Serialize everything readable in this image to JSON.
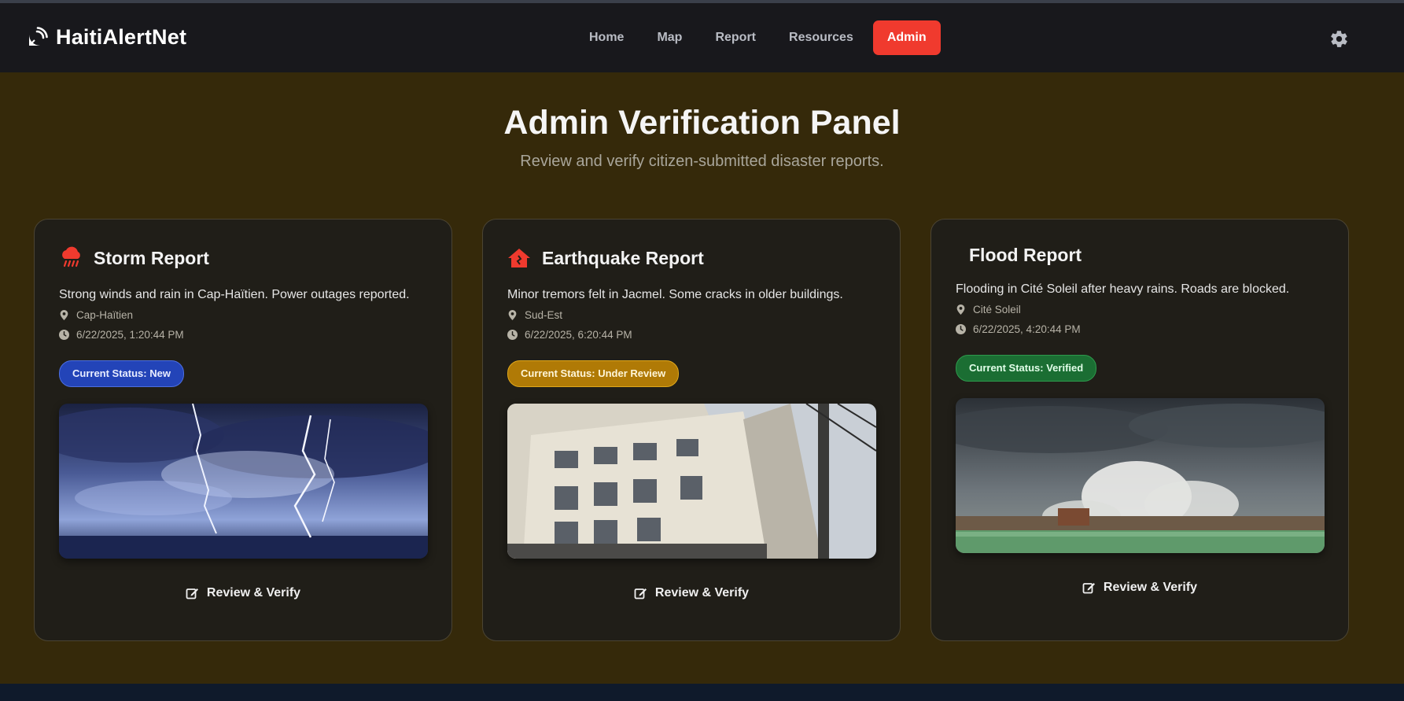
{
  "brand": {
    "name": "HaitiAlertNet",
    "icon": "satellite-dish-icon"
  },
  "nav": {
    "links": [
      "Home",
      "Map",
      "Report",
      "Resources",
      "Admin"
    ],
    "active": "Admin",
    "settings_icon": "gear-icon"
  },
  "page": {
    "title": "Admin Verification Panel",
    "subtitle": "Review and verify citizen-submitted disaster reports."
  },
  "reports": [
    {
      "title": "Storm Report",
      "icon": "cloud-rain-icon",
      "description": "Strong winds and rain in Cap-Haïtien. Power outages reported.",
      "location": "Cap-Haïtien",
      "timestamp": "6/22/2025, 1:20:44 PM",
      "status": "Current Status: New",
      "image": "lightning-storm-photo",
      "action": "Review & Verify"
    },
    {
      "title": "Earthquake Report",
      "icon": "house-damage-icon",
      "description": "Minor tremors felt in Jacmel. Some cracks in older buildings.",
      "location": "Sud-Est",
      "timestamp": "6/22/2025, 6:20:44 PM",
      "status": "Current Status: Under Review",
      "image": "tilted-buildings-photo",
      "action": "Review & Verify"
    },
    {
      "title": "Flood Report",
      "icon": "",
      "description": "Flooding in Cité Soleil after heavy rains. Roads are blocked.",
      "location": "Cité Soleil",
      "timestamp": "6/22/2025, 4:20:44 PM",
      "status": "Current Status: Verified",
      "image": "wave-crashing-photo",
      "action": "Review & Verify"
    }
  ],
  "colors": {
    "accent": "#f03a2e",
    "background": "#35290a",
    "status_new": "#2344b8",
    "status_review": "#b07a06",
    "status_verified": "#1b6e33"
  }
}
